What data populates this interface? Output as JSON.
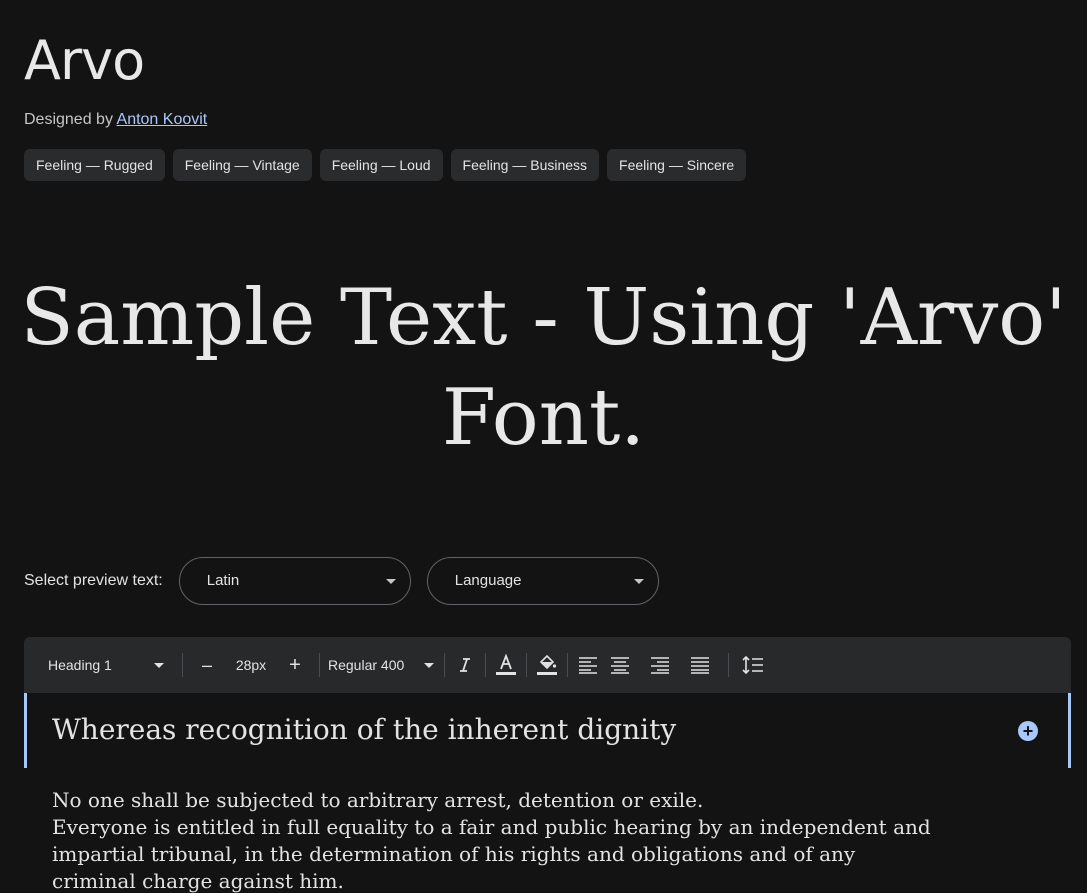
{
  "font": {
    "name": "Arvo",
    "designed_by_label": "Designed by",
    "designer": "Anton Koovit"
  },
  "tags": [
    "Feeling — Rugged",
    "Feeling — Vintage",
    "Feeling — Loud",
    "Feeling — Business",
    "Feeling — Sincere"
  ],
  "sample_text": {
    "line1": "Sample Text - Using 'Arvo'",
    "line2": "Font."
  },
  "preview": {
    "label": "Select preview text:",
    "script_select": "Latin",
    "language_select": "Language"
  },
  "toolbar": {
    "style": "Heading 1",
    "decrease": "–",
    "size": "28px",
    "increase": "+",
    "weight": "Regular 400",
    "icons": [
      "italic-icon",
      "text-color-icon",
      "highlight-color-icon",
      "align-left-icon",
      "align-center-icon",
      "align-right-icon",
      "align-justify-icon",
      "line-spacing-icon"
    ]
  },
  "editor": {
    "heading": "Whereas recognition of the inherent dignity",
    "paragraph_lines": [
      "No one shall be subjected to arbitrary arrest, detention or exile.",
      "Everyone is entitled in full equality to a fair and public hearing by an independent and",
      "impartial tribunal, in the determination of his rights and obligations and of any",
      "criminal charge against him."
    ]
  },
  "colors": {
    "background": "#131314",
    "toolbar": "#28292b",
    "accent": "#a8c7fa",
    "tag_bg": "#2a2b2d"
  }
}
